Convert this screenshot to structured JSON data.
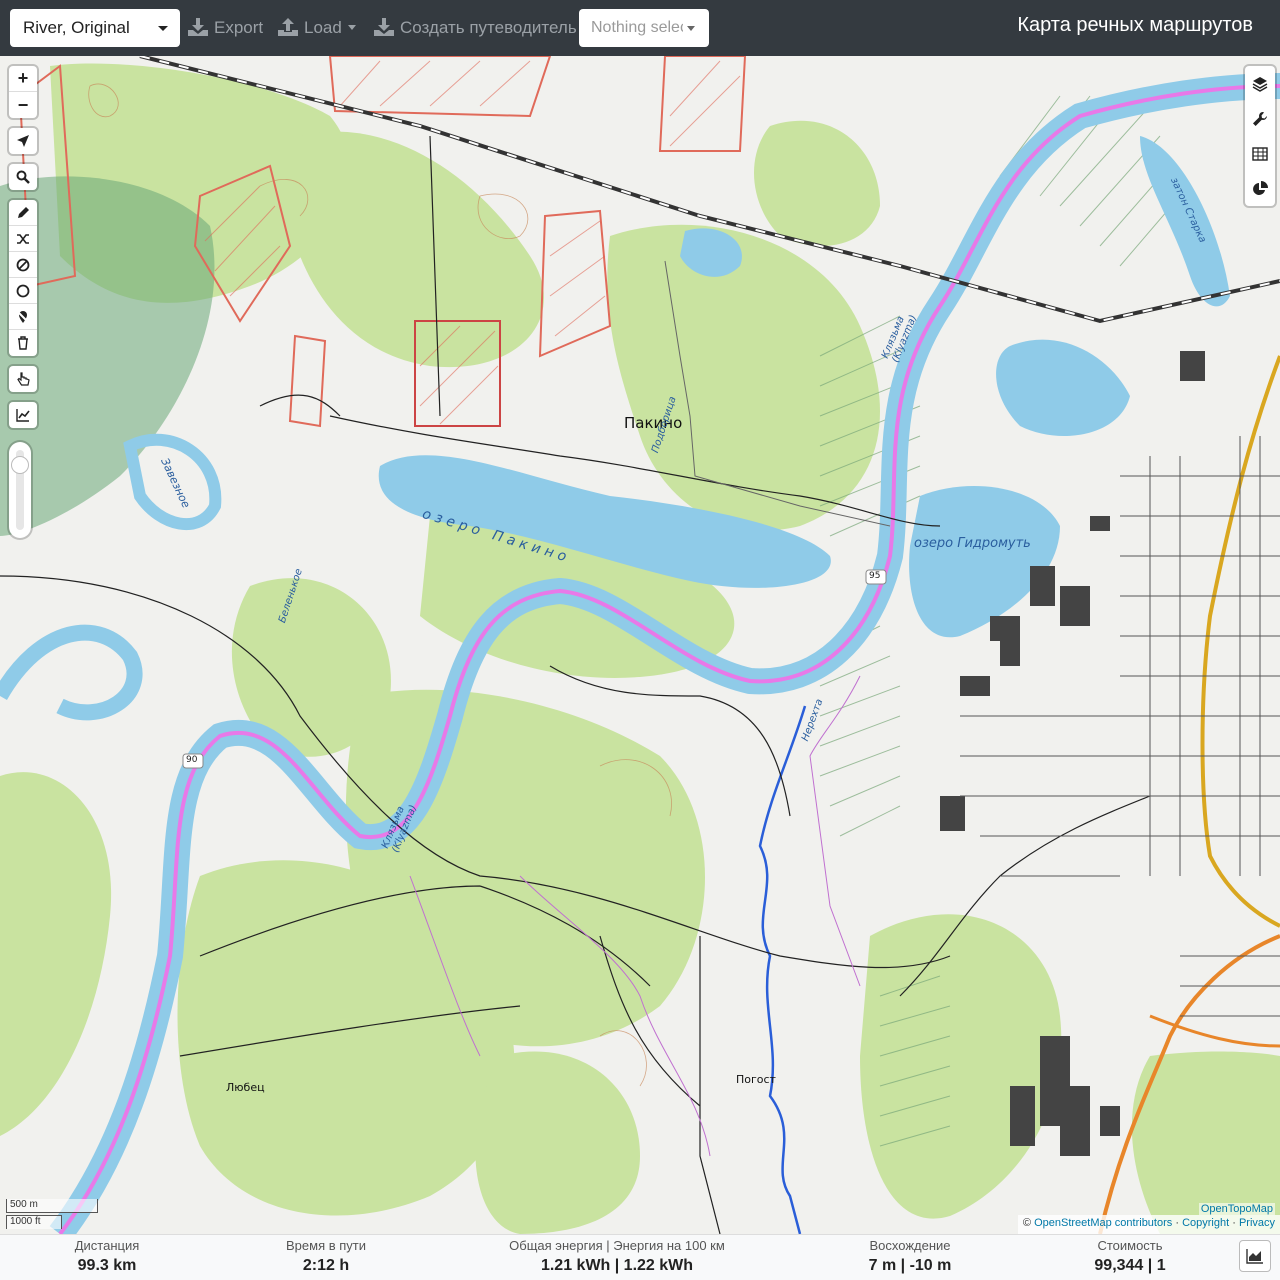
{
  "topbar": {
    "profile": "River, Original",
    "export_label": "Export",
    "load_label": "Load",
    "guide_label": "Создать путеводитель",
    "nothing_selected": "Nothing selected",
    "app_title": "Карта речных маршрутов"
  },
  "map": {
    "labels": {
      "pakino": "Пакино",
      "lake_pakino": "о з е р о   П а к и н о",
      "lake_gidromut": "озеро Гидромуть",
      "zavezhnoe": "Завезное",
      "belenkoe": "Беленькое",
      "podborica": "Подборица",
      "klyazma_upper": "Клязьма (Klyazma)",
      "klyazma_lower": "Клязьма (Klyazma)",
      "nerekhta": "Нерехта",
      "zaton_starka": "затон Старка",
      "lyubets": "Любец",
      "pogost": "Погост",
      "road_95": "95",
      "road_90": "90"
    },
    "scale": {
      "metric": "500 m",
      "imperial": "1000 ft"
    },
    "attribution": {
      "leaflet": "©",
      "osm": "OpenStreetMap contributors",
      "sep1": "·",
      "copyright": "Copyright",
      "sep2": "·",
      "privacy": "Privacy",
      "otm": "OpenTopoMap"
    }
  },
  "stats": {
    "distance": {
      "title": "Дистанция",
      "value": "99.3 km"
    },
    "time": {
      "title": "Время в пути",
      "value": "2:12 h"
    },
    "energy": {
      "title": "Общая энергия | Энергия на 100 км",
      "value": "1.21 kWh | 1.22 kWh"
    },
    "ascent": {
      "title": "Восхождение",
      "value": "7 m | -10 m"
    },
    "cost": {
      "title": "Стоимость",
      "value": "99,344 | 1"
    }
  },
  "colors": {
    "route": "#e879e8",
    "river": "#8fcbe8",
    "forest": "#c9e3a0",
    "topbar": "#343a40"
  },
  "icons": {
    "left_toolbar": [
      "plus-icon",
      "minus-icon",
      "locate-arrow-icon",
      "search-icon",
      "pencil-icon",
      "shuffle-icon",
      "no-entry-icon",
      "circle-icon",
      "pin-off-icon",
      "trash-icon",
      "hand-pointer-icon",
      "chart-line-icon"
    ],
    "right_toolbar": [
      "layers-icon",
      "wrench-icon",
      "table-icon",
      "pie-chart-icon"
    ]
  }
}
